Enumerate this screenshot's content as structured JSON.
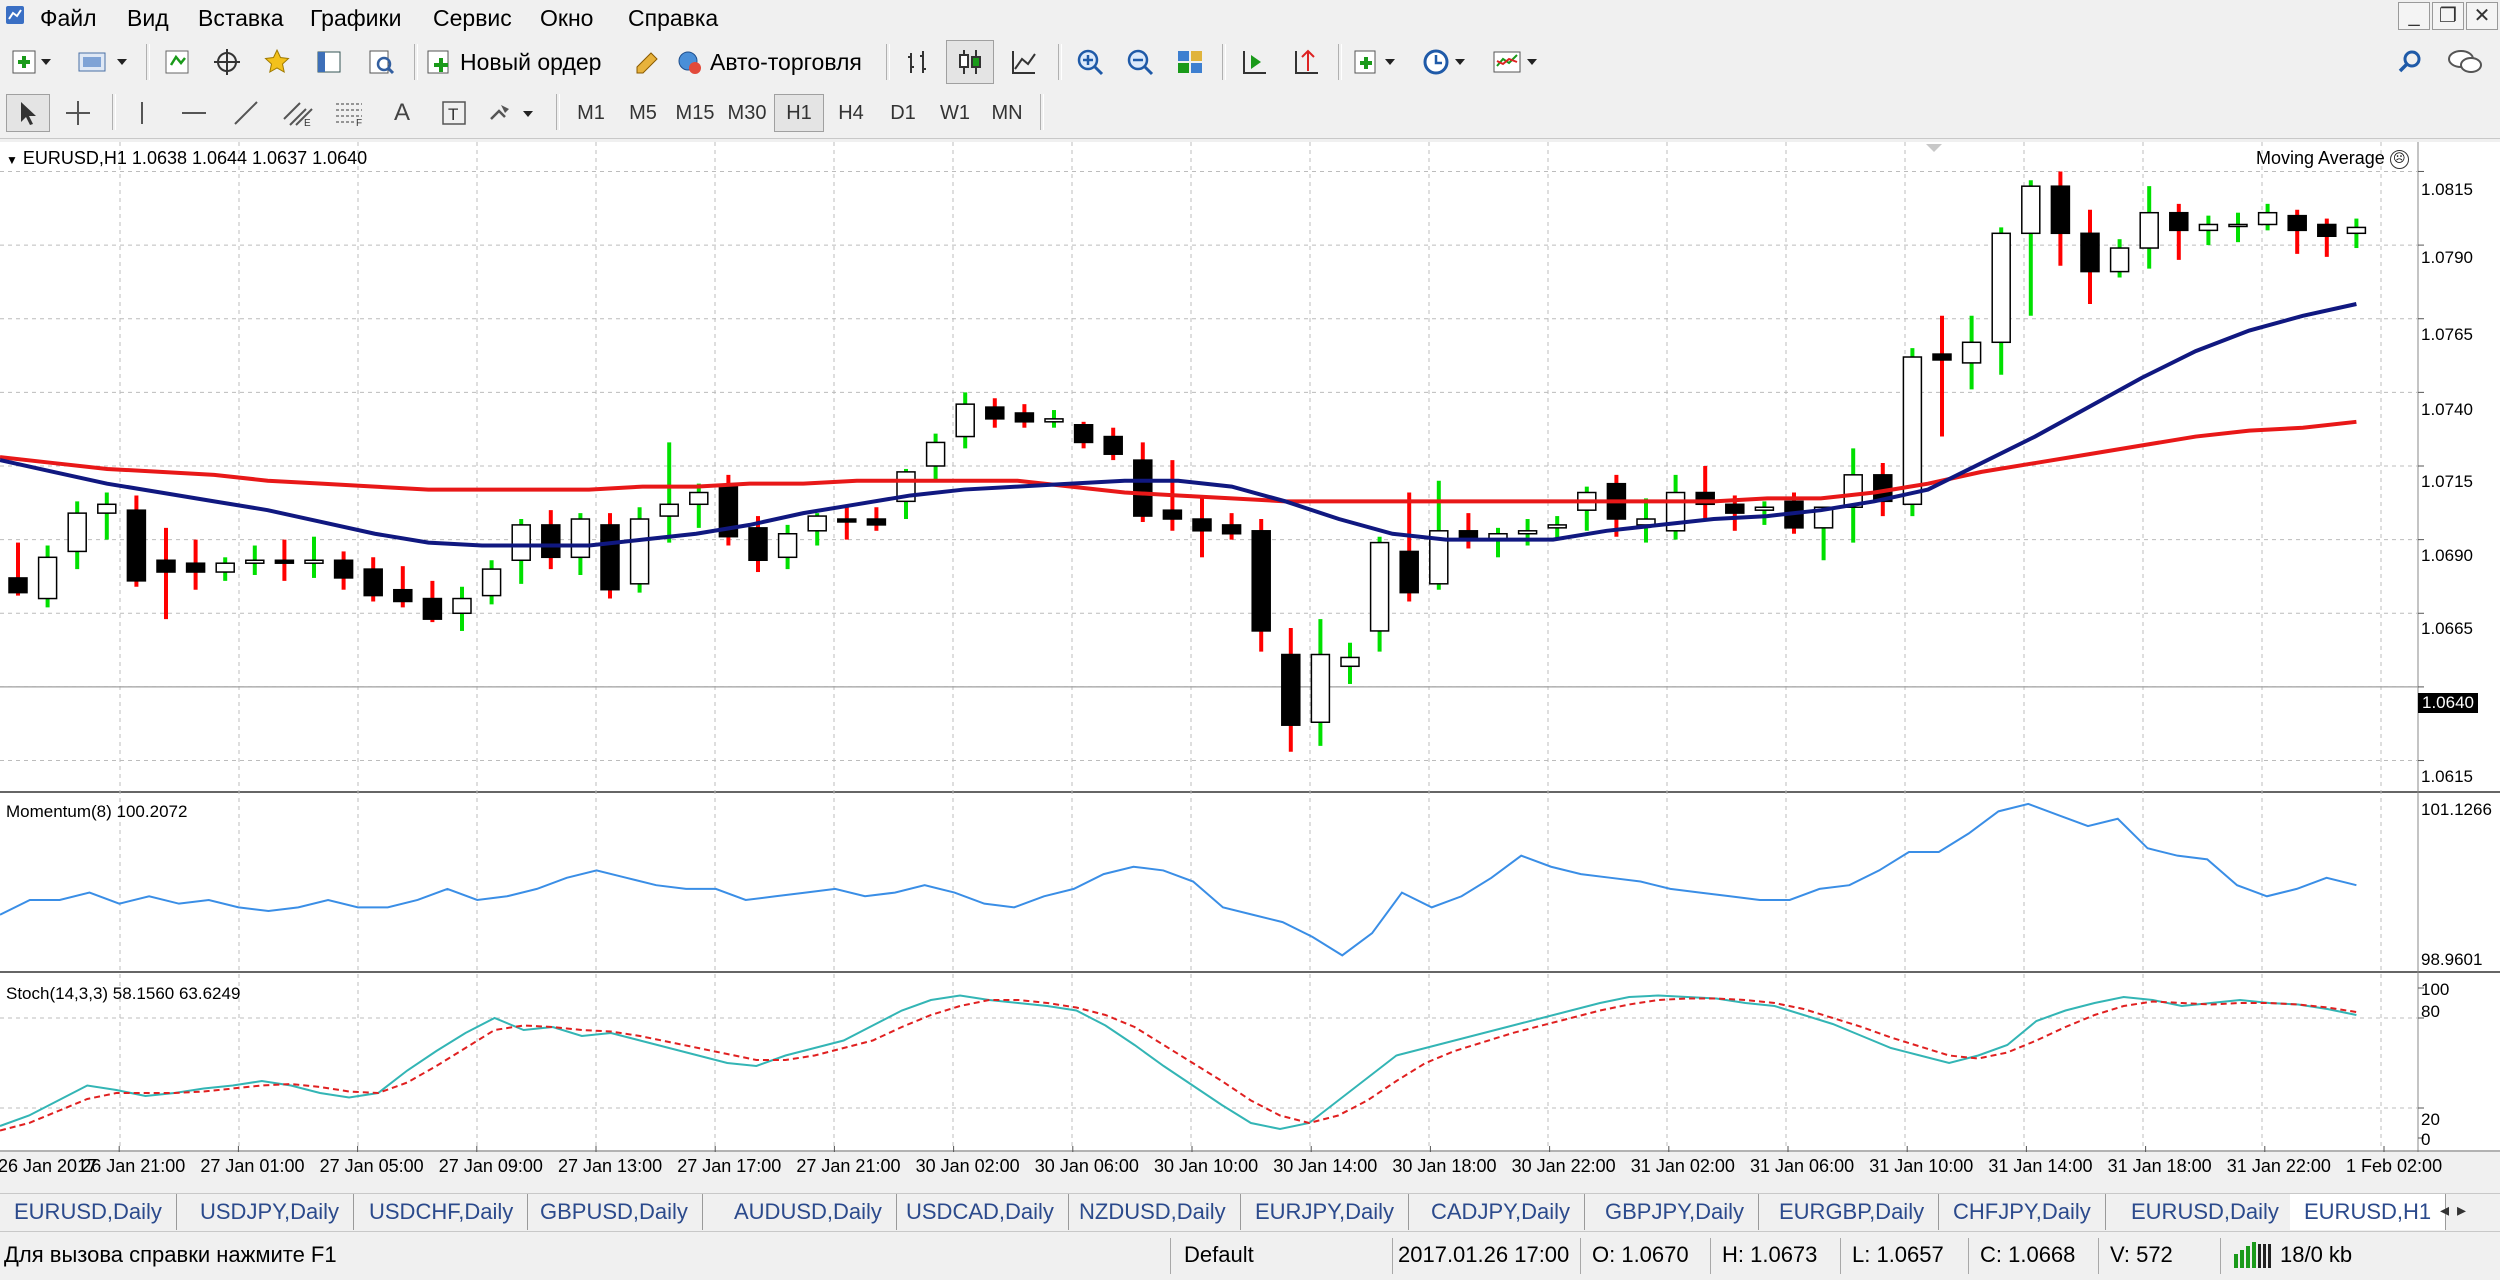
{
  "menu": {
    "items": [
      "Файл",
      "Вид",
      "Вставка",
      "Графики",
      "Сервис",
      "Окно",
      "Справка"
    ]
  },
  "toolbar": {
    "new_order_label": "Новый ордер",
    "auto_trading_label": "Авто-торговля",
    "timeframes": [
      "M1",
      "M5",
      "M15",
      "M30",
      "H1",
      "H4",
      "D1",
      "W1",
      "MN"
    ],
    "active_timeframe": "H1"
  },
  "chart": {
    "header": "EURUSD,H1  1.0638 1.0644 1.0637 1.0640",
    "indicator_label": "Moving Average",
    "price_ticks": [
      "1.0815",
      "1.0790",
      "1.0765",
      "1.0740",
      "1.0715",
      "1.0690",
      "1.0665",
      "1.0640",
      "1.0615"
    ],
    "current_price": "1.0640",
    "momentum_label": "Momentum(8) 100.2072",
    "momentum_ticks": [
      "101.1266",
      "98.9601"
    ],
    "stoch_label": "Stoch(14,3,3) 58.1560 63.6249",
    "stoch_ticks": [
      "100",
      "80",
      "20",
      "0"
    ],
    "time_labels": [
      "26 Jan 2017",
      "26 Jan 21:00",
      "27 Jan 01:00",
      "27 Jan 05:00",
      "27 Jan 09:00",
      "27 Jan 13:00",
      "27 Jan 17:00",
      "27 Jan 21:00",
      "30 Jan 02:00",
      "30 Jan 06:00",
      "30 Jan 10:00",
      "30 Jan 14:00",
      "30 Jan 18:00",
      "30 Jan 22:00",
      "31 Jan 02:00",
      "31 Jan 06:00",
      "31 Jan 10:00",
      "31 Jan 14:00",
      "31 Jan 18:00",
      "31 Jan 22:00",
      "1 Feb 02:00"
    ],
    "colors": {
      "bull_candle": "#ffffff",
      "bear_candle": "#000000",
      "up_wick": "#00e000",
      "down_wick": "#ff0000",
      "ma_fast": "#101880",
      "ma_slow": "#e81818",
      "momentum": "#3a8ee6",
      "stoch_main": "#33b5b5",
      "stoch_signal": "#e02020"
    }
  },
  "chart_data": [
    {
      "type": "candlestick",
      "title": "EURUSD,H1",
      "ylim": [
        1.0605,
        1.0825
      ],
      "ohlc": [
        [
          1.0677,
          1.0689,
          1.0671,
          1.0672
        ],
        [
          1.067,
          1.0688,
          1.0667,
          1.0684
        ],
        [
          1.0686,
          1.0703,
          1.068,
          1.0699
        ],
        [
          1.0699,
          1.0706,
          1.069,
          1.0702
        ],
        [
          1.07,
          1.0705,
          1.0674,
          1.0676
        ],
        [
          1.0683,
          1.0694,
          1.0663,
          1.0679
        ],
        [
          1.0682,
          1.069,
          1.0673,
          1.0679
        ],
        [
          1.0679,
          1.0684,
          1.0676,
          1.0682
        ],
        [
          1.0682,
          1.0688,
          1.0678,
          1.0683
        ],
        [
          1.0683,
          1.069,
          1.0676,
          1.0682
        ],
        [
          1.0682,
          1.0691,
          1.0677,
          1.0683
        ],
        [
          1.0683,
          1.0686,
          1.0673,
          1.0677
        ],
        [
          1.068,
          1.0684,
          1.0669,
          1.0671
        ],
        [
          1.0673,
          1.0681,
          1.0667,
          1.0669
        ],
        [
          1.067,
          1.0676,
          1.0662,
          1.0663
        ],
        [
          1.0665,
          1.0674,
          1.0659,
          1.067
        ],
        [
          1.0671,
          1.0683,
          1.0668,
          1.068
        ],
        [
          1.0683,
          1.0697,
          1.0675,
          1.0695
        ],
        [
          1.0695,
          1.07,
          1.068,
          1.0684
        ],
        [
          1.0684,
          1.0699,
          1.0678,
          1.0697
        ],
        [
          1.0695,
          1.0699,
          1.067,
          1.0673
        ],
        [
          1.0675,
          1.0701,
          1.0672,
          1.0697
        ],
        [
          1.0698,
          1.0723,
          1.0689,
          1.0702
        ],
        [
          1.0702,
          1.0709,
          1.0694,
          1.0706
        ],
        [
          1.0708,
          1.0712,
          1.0688,
          1.0691
        ],
        [
          1.0694,
          1.0698,
          1.0679,
          1.0683
        ],
        [
          1.0684,
          1.0695,
          1.068,
          1.0692
        ],
        [
          1.0693,
          1.0699,
          1.0688,
          1.0698
        ],
        [
          1.0697,
          1.0701,
          1.069,
          1.0696
        ],
        [
          1.0697,
          1.0701,
          1.0693,
          1.0695
        ],
        [
          1.0703,
          1.0714,
          1.0697,
          1.0713
        ],
        [
          1.0715,
          1.0726,
          1.071,
          1.0723
        ],
        [
          1.0725,
          1.074,
          1.0721,
          1.0736
        ],
        [
          1.0735,
          1.0738,
          1.0728,
          1.0731
        ],
        [
          1.0733,
          1.0736,
          1.0728,
          1.073
        ],
        [
          1.073,
          1.0734,
          1.0728,
          1.0731
        ],
        [
          1.0729,
          1.073,
          1.0721,
          1.0723
        ],
        [
          1.0725,
          1.0728,
          1.0717,
          1.0719
        ],
        [
          1.0717,
          1.0723,
          1.0696,
          1.0698
        ],
        [
          1.07,
          1.0717,
          1.0693,
          1.0697
        ],
        [
          1.0697,
          1.0704,
          1.0684,
          1.0693
        ],
        [
          1.0695,
          1.0699,
          1.069,
          1.0692
        ],
        [
          1.0693,
          1.0697,
          1.0652,
          1.0659
        ],
        [
          1.0651,
          1.066,
          1.0618,
          1.0627
        ],
        [
          1.0628,
          1.0663,
          1.062,
          1.0651
        ],
        [
          1.0647,
          1.0655,
          1.0641,
          1.065
        ],
        [
          1.0659,
          1.0691,
          1.0652,
          1.0689
        ],
        [
          1.0686,
          1.0706,
          1.0669,
          1.0672
        ],
        [
          1.0675,
          1.071,
          1.0673,
          1.0693
        ],
        [
          1.0693,
          1.0699,
          1.0687,
          1.069
        ],
        [
          1.069,
          1.0694,
          1.0684,
          1.0692
        ],
        [
          1.0692,
          1.0697,
          1.0688,
          1.0693
        ],
        [
          1.0694,
          1.0698,
          1.069,
          1.0695
        ],
        [
          1.07,
          1.0708,
          1.0693,
          1.0706
        ],
        [
          1.0709,
          1.0712,
          1.0691,
          1.0697
        ],
        [
          1.0695,
          1.0704,
          1.0689,
          1.0697
        ],
        [
          1.0693,
          1.0712,
          1.069,
          1.0706
        ],
        [
          1.0706,
          1.0715,
          1.0697,
          1.0702
        ],
        [
          1.0702,
          1.0705,
          1.0693,
          1.0699
        ],
        [
          1.07,
          1.0703,
          1.0695,
          1.0701
        ],
        [
          1.0703,
          1.0706,
          1.0692,
          1.0694
        ],
        [
          1.0694,
          1.07,
          1.0683,
          1.0701
        ],
        [
          1.0701,
          1.0721,
          1.0689,
          1.0712
        ],
        [
          1.0712,
          1.0716,
          1.0698,
          1.0703
        ],
        [
          1.0702,
          1.0755,
          1.0698,
          1.0752
        ],
        [
          1.0753,
          1.0766,
          1.0725,
          1.0751
        ],
        [
          1.075,
          1.0766,
          1.0741,
          1.0757
        ],
        [
          1.0757,
          1.0796,
          1.0746,
          1.0794
        ],
        [
          1.0794,
          1.0812,
          1.0766,
          1.081
        ],
        [
          1.081,
          1.0815,
          1.0783,
          1.0794
        ],
        [
          1.0794,
          1.0802,
          1.077,
          1.0781
        ],
        [
          1.0781,
          1.0792,
          1.0779,
          1.0789
        ],
        [
          1.0789,
          1.081,
          1.0782,
          1.0801
        ],
        [
          1.0801,
          1.0804,
          1.0785,
          1.0795
        ],
        [
          1.0795,
          1.08,
          1.079,
          1.0797
        ],
        [
          1.0797,
          1.0801,
          1.0791,
          1.0797
        ],
        [
          1.0797,
          1.0804,
          1.0795,
          1.0801
        ],
        [
          1.08,
          1.0802,
          1.0787,
          1.0795
        ],
        [
          1.0797,
          1.0799,
          1.0786,
          1.0793
        ],
        [
          1.0794,
          1.0799,
          1.0789,
          1.0796
        ]
      ],
      "ma_fast": [
        1.0717,
        1.0713,
        1.0709,
        1.0706,
        1.0703,
        1.07,
        1.0696,
        1.0692,
        1.0689,
        1.0688,
        1.0688,
        1.0688,
        1.069,
        1.0692,
        1.0695,
        1.0699,
        1.0702,
        1.0705,
        1.0707,
        1.0708,
        1.0709,
        1.071,
        1.071,
        1.0708,
        1.0703,
        1.0697,
        1.0692,
        1.069,
        1.069,
        1.069,
        1.0693,
        1.0695,
        1.0697,
        1.0698,
        1.07,
        1.0703,
        1.0707,
        1.0716,
        1.0725,
        1.0735,
        1.0745,
        1.0754,
        1.0761,
        1.0766,
        1.077
      ],
      "ma_slow": [
        1.0718,
        1.0716,
        1.0714,
        1.0713,
        1.0712,
        1.071,
        1.0709,
        1.0708,
        1.0707,
        1.0707,
        1.0707,
        1.0707,
        1.0708,
        1.0708,
        1.0709,
        1.0709,
        1.071,
        1.071,
        1.071,
        1.071,
        1.0708,
        1.0706,
        1.0705,
        1.0704,
        1.0703,
        1.0703,
        1.0703,
        1.0703,
        1.0703,
        1.0703,
        1.0703,
        1.0703,
        1.0703,
        1.0704,
        1.0704,
        1.0706,
        1.0709,
        1.0713,
        1.0716,
        1.0719,
        1.0722,
        1.0725,
        1.0727,
        1.0728,
        1.073
      ]
    },
    {
      "type": "line",
      "title": "Momentum(8) 100.2072",
      "ylim": [
        98.9601,
        101.1266
      ],
      "values": [
        99.6,
        99.8,
        99.8,
        99.9,
        99.75,
        99.85,
        99.75,
        99.8,
        99.7,
        99.65,
        99.7,
        99.8,
        99.7,
        99.7,
        99.8,
        99.95,
        99.8,
        99.85,
        99.95,
        100.1,
        100.2,
        100.1,
        100.0,
        99.95,
        99.95,
        99.8,
        99.85,
        99.9,
        99.95,
        99.85,
        99.9,
        100.0,
        99.9,
        99.75,
        99.7,
        99.85,
        99.95,
        100.15,
        100.25,
        100.2,
        100.05,
        99.7,
        99.6,
        99.5,
        99.3,
        99.05,
        99.35,
        99.9,
        99.7,
        99.85,
        100.1,
        100.4,
        100.25,
        100.15,
        100.1,
        100.05,
        99.95,
        99.9,
        99.85,
        99.8,
        99.8,
        99.95,
        100.0,
        100.2,
        100.45,
        100.45,
        100.7,
        101.0,
        101.1,
        100.95,
        100.8,
        100.9,
        100.5,
        100.4,
        100.35,
        100.0,
        99.85,
        99.95,
        100.1,
        100.0
      ]
    },
    {
      "type": "line",
      "title": "Stoch(14,3,3) 58.1560 63.6249",
      "ylim": [
        0,
        100
      ],
      "series": [
        {
          "name": "main",
          "values": [
            8,
            15,
            25,
            35,
            32,
            28,
            30,
            33,
            35,
            38,
            35,
            30,
            27,
            30,
            45,
            58,
            70,
            80,
            72,
            74,
            68,
            70,
            65,
            60,
            55,
            50,
            48,
            55,
            60,
            65,
            75,
            85,
            92,
            95,
            92,
            90,
            88,
            85,
            75,
            62,
            48,
            35,
            22,
            10,
            6,
            10,
            25,
            40,
            55,
            60,
            65,
            70,
            75,
            80,
            85,
            90,
            94,
            95,
            94,
            93,
            90,
            88,
            82,
            76,
            68,
            60,
            55,
            50,
            55,
            62,
            78,
            85,
            90,
            94,
            92,
            88,
            90,
            92,
            90,
            89,
            86,
            82
          ]
        },
        {
          "name": "signal",
          "values": [
            5,
            10,
            18,
            26,
            30,
            30,
            30,
            31,
            33,
            35,
            36,
            34,
            31,
            30,
            37,
            48,
            60,
            72,
            75,
            74,
            72,
            71,
            68,
            64,
            60,
            56,
            52,
            52,
            55,
            60,
            65,
            74,
            82,
            88,
            92,
            92,
            90,
            87,
            82,
            74,
            62,
            50,
            38,
            25,
            15,
            10,
            15,
            25,
            38,
            50,
            58,
            64,
            70,
            75,
            80,
            85,
            89,
            92,
            93,
            93,
            92,
            90,
            86,
            80,
            74,
            67,
            61,
            55,
            53,
            57,
            65,
            74,
            82,
            88,
            91,
            90,
            89,
            90,
            90,
            89,
            87,
            84
          ]
        }
      ]
    }
  ],
  "tabs": [
    "EURUSD,Daily",
    "USDJPY,Daily",
    "USDCHF,Daily",
    "GBPUSD,Daily",
    "AUDUSD,Daily",
    "USDCAD,Daily",
    "NZDUSD,Daily",
    "EURJPY,Daily",
    "CADJPY,Daily",
    "GBPJPY,Daily",
    "EURGBP,Daily",
    "CHFJPY,Daily",
    "EURUSD,Daily",
    "EURUSD,H1"
  ],
  "status": {
    "help": "Для вызова справки нажмите F1",
    "profile": "Default",
    "datetime": "2017.01.26 17:00",
    "open": "O: 1.0670",
    "high": "H: 1.0673",
    "low": "L: 1.0657",
    "close": "C: 1.0668",
    "volume": "V: 572",
    "traffic": "18/0 kb"
  }
}
